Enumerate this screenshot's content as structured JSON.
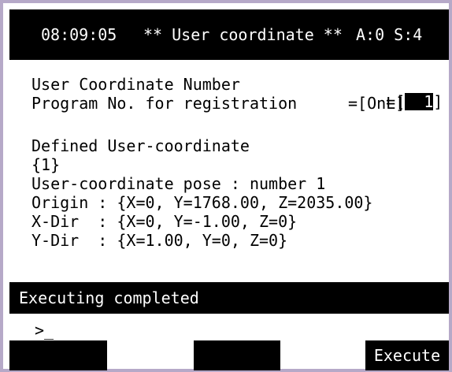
{
  "header": {
    "time": "08:09:05",
    "title": "** User coordinate **",
    "status": "A:0 S:4"
  },
  "fields": [
    {
      "label": "User Coordinate Number",
      "prefix": "=[",
      "value": "1",
      "suffix": "]"
    },
    {
      "label": "Program No. for registration",
      "value": "=[OnL]"
    }
  ],
  "defined": {
    "heading": "Defined User-coordinate",
    "index": "{1}",
    "pose": "User-coordinate pose : number 1",
    "origin": "Origin : {X=0, Y=1768.00, Z=2035.00}",
    "xdir": "X-Dir  : {X=0, Y=-1.00, Z=0}",
    "ydir": "Y-Dir  : {X=1.00, Y=0, Z=0}"
  },
  "status_message": "Executing completed",
  "prompt": ">_",
  "function_keys": [
    "",
    "",
    "",
    "Execute"
  ],
  "colors": {
    "frame_border": "#b6a9c8",
    "bar": "#000000",
    "text_inverse": "#ffffff"
  }
}
